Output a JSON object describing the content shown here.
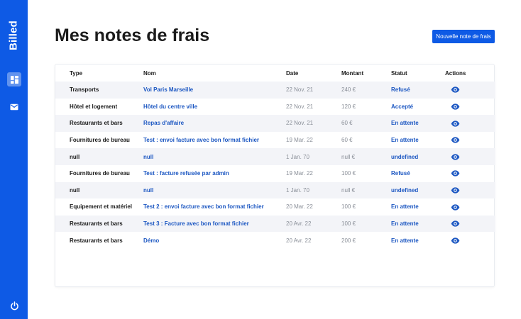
{
  "sidebar": {
    "brand": "Billed",
    "items": [
      {
        "icon": "bills-icon",
        "active": true
      },
      {
        "icon": "mail-icon",
        "active": false
      },
      {
        "icon": "power-icon",
        "active": false
      }
    ]
  },
  "header": {
    "title": "Mes notes de frais",
    "new_bill_label": "Nouvelle note de frais"
  },
  "table": {
    "columns": [
      "Type",
      "Nom",
      "Date",
      "Montant",
      "Statut",
      "Actions"
    ],
    "rows": [
      {
        "type": "Transports",
        "name": "Vol Paris Marseille",
        "date": "22 Nov. 21",
        "amount": "240 €",
        "status": "Refusé"
      },
      {
        "type": "Hôtel et logement",
        "name": "Hôtel du centre ville",
        "date": "22 Nov. 21",
        "amount": "120 €",
        "status": "Accepté"
      },
      {
        "type": "Restaurants et bars",
        "name": "Repas d'affaire",
        "date": "22 Nov. 21",
        "amount": "60 €",
        "status": "En attente"
      },
      {
        "type": "Fournitures de bureau",
        "name": "Test : envoi facture avec bon format fichier",
        "date": "19 Mar. 22",
        "amount": "60 €",
        "status": "En attente"
      },
      {
        "type": "null",
        "name": "null",
        "date": "1 Jan. 70",
        "amount": "null €",
        "status": "undefined"
      },
      {
        "type": "Fournitures de bureau",
        "name": "Test : facture refusée par admin",
        "date": "19 Mar. 22",
        "amount": "100 €",
        "status": "Refusé"
      },
      {
        "type": "null",
        "name": "null",
        "date": "1 Jan. 70",
        "amount": "null €",
        "status": "undefined"
      },
      {
        "type": "Equipement et matériel",
        "name": "Test 2 : envoi facture avec bon format fichier",
        "date": "20 Mar. 22",
        "amount": "100 €",
        "status": "En attente"
      },
      {
        "type": "Restaurants et bars",
        "name": "Test 3 : Facture avec bon format fichier",
        "date": "20 Avr. 22",
        "amount": "100 €",
        "status": "En attente"
      },
      {
        "type": "Restaurants et bars",
        "name": "Démo",
        "date": "20 Avr. 22",
        "amount": "200 €",
        "status": "En attente"
      }
    ]
  },
  "colors": {
    "primary": "#0e5ae5",
    "link": "#1c57c2",
    "muted": "#8a8f98",
    "row_stripe": "#f3f4f8"
  }
}
